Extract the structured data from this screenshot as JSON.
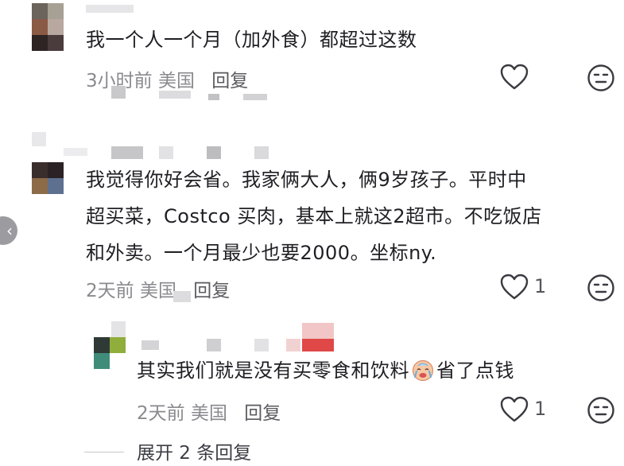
{
  "comments": [
    {
      "text": "我一个人一个月（加外食）都超过这数",
      "time": "3小时前",
      "location": "美国",
      "reply_label": "回复"
    },
    {
      "text_lines": [
        "我觉得你好会省。我家俩大人，俩9岁孩子。平时中",
        "超买菜，Costco 买肉，基本上就这2超市。不吃饭店",
        "和外卖。一个月最少也要2000。坐标ny."
      ],
      "time": "2天前",
      "location": "美国",
      "reply_label": "回复",
      "likes": "1"
    },
    {
      "text_before_emoji": "其实我们就是没有买零食和饮料",
      "text_after_emoji": "省了点钱",
      "time": "2天前",
      "location": "美国",
      "reply_label": "回复",
      "likes": "1"
    }
  ],
  "expand_label": "展开 2 条回复",
  "icons": {
    "like": "heart-outline-icon",
    "dislike": "neutral-face-icon",
    "emoji": "crying-face-emoji",
    "scroll": "chevron-left-icon"
  },
  "colors": {
    "text": "#1f1f24",
    "meta": "#8a8a8f",
    "icon": "#3a3a40"
  }
}
